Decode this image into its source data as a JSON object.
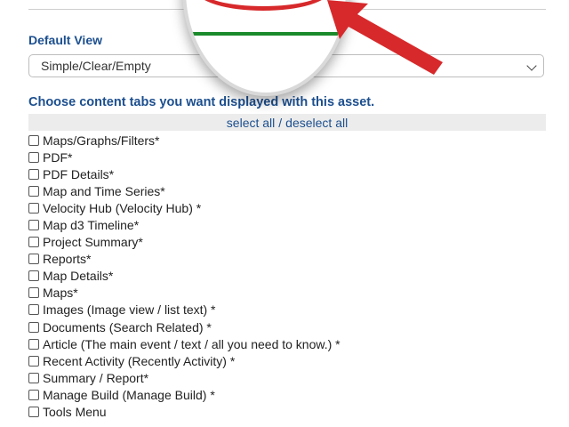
{
  "default_view": {
    "label": "Default View",
    "selected": "Simple/Clear/Empty"
  },
  "tabs_section": {
    "heading": "Choose content tabs you want displayed with this asset.",
    "select_all": "select all",
    "separator": "/",
    "deselect_all": "deselect all",
    "items": [
      "Maps/Graphs/Filters*",
      "PDF*",
      "PDF Details*",
      "Map and Time Series*",
      "Velocity Hub (Velocity Hub) *",
      "Map d3 Timeline*",
      "Project Summary*",
      "Reports*",
      "Map Details*",
      "Maps*",
      "Images (Image view / list text) *",
      "Documents (Search Related) *",
      "Article (The main event / text / all you need to know.) *",
      "Recent Activity (Recently Activity) *",
      "Summary / Report*",
      "Manage Build (Manage Build) *",
      "Tools Menu"
    ]
  },
  "colors": {
    "accent": "#1c4f8f",
    "highlight_red": "#d7292b",
    "zoom_green": "#1a8a2a"
  }
}
